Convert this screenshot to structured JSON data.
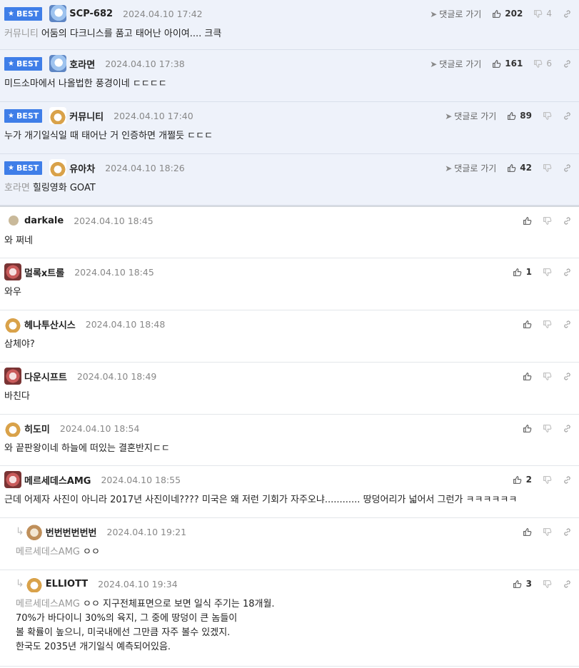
{
  "labels": {
    "best": "BEST",
    "reply_to": "댓글로 가기"
  },
  "comments": [
    {
      "best": true,
      "avatar": "blue",
      "nick": "SCP-682",
      "date": "2024.04.10 17:42",
      "likes": "202",
      "dislikes": "4",
      "ref": "커뮤니티",
      "text": "어둠의 다크니스를 품고 태어난 아이여.... 크큭"
    },
    {
      "best": true,
      "avatar": "blue",
      "nick": "호라면",
      "date": "2024.04.10 17:38",
      "likes": "161",
      "dislikes": "6",
      "ref": "",
      "text": "미드소마에서 나올법한 풍경이네 ㄷㄷㄷㄷ"
    },
    {
      "best": true,
      "avatar": "fox",
      "nick": "커뮤니티",
      "date": "2024.04.10 17:40",
      "likes": "89",
      "dislikes": "",
      "ref": "",
      "text": "누가 개기일식일 때 태어난 거 인증하면 개쩔듯 ㄷㄷㄷ"
    },
    {
      "best": true,
      "avatar": "fox",
      "nick": "유아차",
      "date": "2024.04.10 18:26",
      "likes": "42",
      "dislikes": "",
      "ref": "호라면",
      "text": "힐링영화 GOAT"
    },
    {
      "best": false,
      "avatar": "dot",
      "nick": "darkale",
      "date": "2024.04.10 18:45",
      "likes": "",
      "dislikes": "",
      "ref": "",
      "text": "와 쩌네"
    },
    {
      "best": false,
      "avatar": "pink",
      "nick": "멀록x트롤",
      "date": "2024.04.10 18:45",
      "likes": "1",
      "dislikes": "",
      "ref": "",
      "text": "와우"
    },
    {
      "best": false,
      "avatar": "fox",
      "nick": "헤나투산시스",
      "date": "2024.04.10 18:48",
      "likes": "",
      "dislikes": "",
      "ref": "",
      "text": "삼체야?"
    },
    {
      "best": false,
      "avatar": "pink",
      "nick": "다운시프트",
      "date": "2024.04.10 18:49",
      "likes": "",
      "dislikes": "",
      "ref": "",
      "text": "바친다"
    },
    {
      "best": false,
      "avatar": "fox",
      "nick": "히도미",
      "date": "2024.04.10 18:54",
      "likes": "",
      "dislikes": "",
      "ref": "",
      "text": "와 끝판왕이네 하늘에 떠있는 결혼반지ㄷㄷ"
    },
    {
      "best": false,
      "avatar": "pink",
      "nick": "메르세데스AMG",
      "date": "2024.04.10 18:55",
      "likes": "2",
      "dislikes": "",
      "ref": "",
      "text": "근데 어제자 사진이 아니라 2017년 사진이네???? 미국은 왜 저런 기회가 자주오냐............ 땅덩어리가 넓어서 그런가 ㅋㅋㅋㅋㅋㅋ"
    },
    {
      "best": false,
      "reply": true,
      "avatar": "dog",
      "nick": "번번번번번번",
      "date": "2024.04.10 19:21",
      "likes": "",
      "dislikes": "",
      "ref": "메르세데스AMG",
      "text": "ㅇㅇ"
    },
    {
      "best": false,
      "reply": true,
      "avatar": "fox",
      "nick": "ELLIOTT",
      "date": "2024.04.10 19:34",
      "likes": "3",
      "dislikes": "",
      "ref": "메르세데스AMG",
      "text": "ㅇㅇ 지구전체표면으로 보면 일식 주기는 18개월.\n70%가 바다이니 30%의 육지, 그 중에 땅덩이 큰 놈들이\n볼 확률이 높으니, 미국내에선 그만큼 자주 볼수 있겠지.\n한국도 2035년 개기일식 예측되어있음."
    }
  ]
}
